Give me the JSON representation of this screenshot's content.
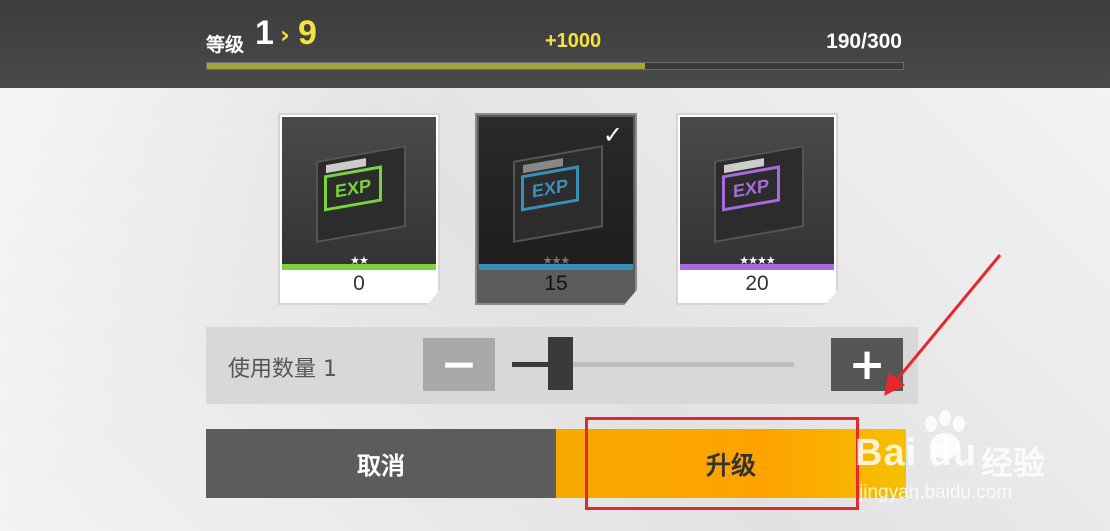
{
  "header": {
    "level_label": "等级",
    "level_from": "1",
    "level_arrow": "›",
    "level_to": "9",
    "exp_gain": "+1000",
    "exp_total": "190/300",
    "progress_fraction": 0.63
  },
  "cards": [
    {
      "count": "0",
      "stars": "★★",
      "accent": "#7ad23c",
      "selected": false
    },
    {
      "count": "15",
      "stars": "★★★",
      "accent": "#3a8fb8",
      "selected": true
    },
    {
      "count": "20",
      "stars": "★★★★",
      "accent": "#a86adc",
      "selected": false
    }
  ],
  "chip_label": "EXP",
  "check_icon": "✓",
  "quantity": {
    "label": "使用数量 1",
    "minus_icon": "−",
    "plus_icon": "+",
    "slider_fraction": 0.13
  },
  "buttons": {
    "cancel": "取消",
    "upgrade": "升级"
  },
  "watermark": {
    "logo": "Bai du",
    "cn": "经验",
    "url": "jingyan.baidu.com"
  },
  "colors": {
    "accent_yellow": "#f3e33c",
    "upgrade_orange": "#ffa200",
    "annotation_red": "#e8262c"
  }
}
